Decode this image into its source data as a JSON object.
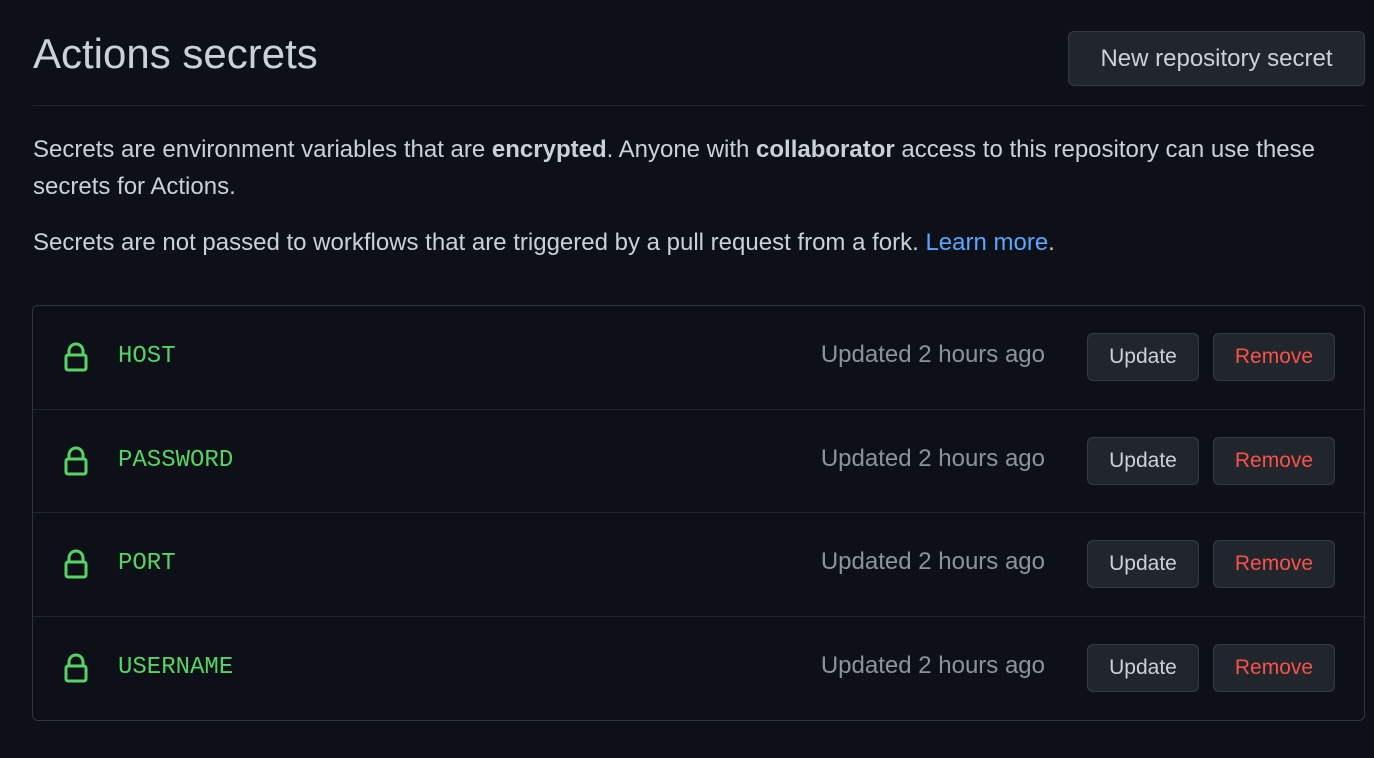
{
  "header": {
    "title": "Actions secrets",
    "new_secret_label": "New repository secret"
  },
  "description": {
    "part1": "Secrets are environment variables that are ",
    "bold1": "encrypted",
    "part2": ". Anyone with ",
    "bold2": "collaborator",
    "part3": " access to this repository can use these secrets for Actions."
  },
  "note": {
    "text": "Secrets are not passed to workflows that are triggered by a pull request from a fork. ",
    "link_label": "Learn more",
    "suffix": "."
  },
  "secrets": [
    {
      "name": "HOST",
      "updated": "Updated 2 hours ago",
      "update_label": "Update",
      "remove_label": "Remove",
      "icon": "lock-icon"
    },
    {
      "name": "PASSWORD",
      "updated": "Updated 2 hours ago",
      "update_label": "Update",
      "remove_label": "Remove",
      "icon": "lock-icon"
    },
    {
      "name": "PORT",
      "updated": "Updated 2 hours ago",
      "update_label": "Update",
      "remove_label": "Remove",
      "icon": "lock-icon"
    },
    {
      "name": "USERNAME",
      "updated": "Updated 2 hours ago",
      "update_label": "Update",
      "remove_label": "Remove",
      "icon": "lock-icon"
    }
  ],
  "colors": {
    "background": "#0d1117",
    "secret_name": "#56d364",
    "link": "#58a6ff",
    "danger": "#f85149",
    "muted": "#8b949e"
  }
}
